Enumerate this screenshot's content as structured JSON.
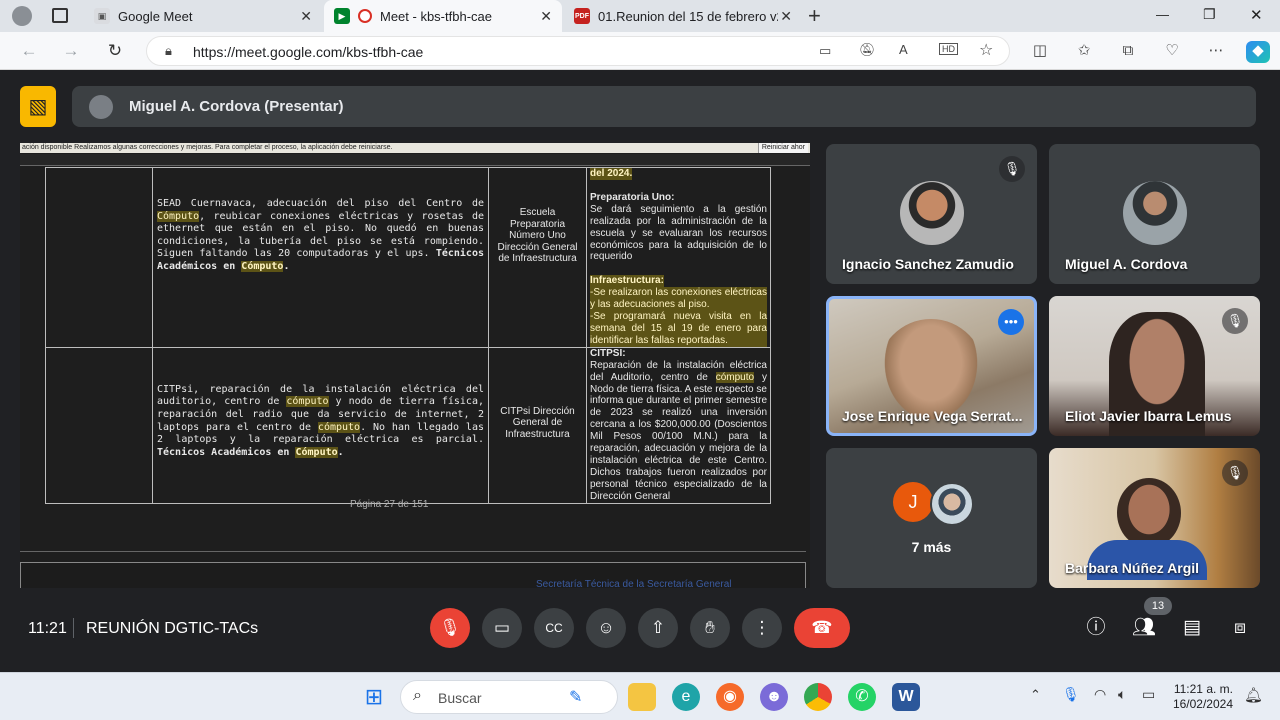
{
  "browser": {
    "tabs": [
      {
        "title": "Google Meet",
        "active": false
      },
      {
        "title": "Meet - kbs-tfbh-cae",
        "active": true
      },
      {
        "title": "01.Reunion del 15 de febrero v2.",
        "active": false
      }
    ],
    "url": "https://meet.google.com/kbs-tfbh-cae",
    "new_tab": "+",
    "window_controls": {
      "minimize": "—",
      "restore": "❐",
      "close": "✕"
    }
  },
  "presenter_bar": {
    "label": "Miguel A. Cordova (Presentar)"
  },
  "document": {
    "update_notice": "ación disponible   Realizamos algunas correcciones y mejoras. Para completar el proceso, la aplicación debe   reiniciarse.",
    "update_button": "Reiniciar ahor",
    "rows": [
      {
        "desc_a": "SEAD Cuernavaca, adecuación del piso del Centro de ",
        "desc_hl1": "Cómputo",
        "desc_b": ", reubicar conexiones eléctricas y rosetas de ethernet que están en el piso. No quedó en buenas condiciones, la tubería del piso se está rompiendo. Siguen faltando las 20 computadoras y el ups. ",
        "desc_bold": "Técnicos Académicos en ",
        "desc_hl2": "Cómputo",
        "desc_end": ".",
        "responsible": "Escuela Preparatoria Número Uno Dirección General de Infraestructura",
        "status_top": "del 2024.",
        "status_h1": "Preparatoria Uno:",
        "status_p1": "Se dará seguimiento a la gestión realizada por la administración de la escuela y se evaluaran los recursos económicos para la adquisición de lo requerido",
        "status_h2": "Infraestructura:",
        "status_p2": "-Se realizaron las conexiones eléctricas y las adecuaciones al piso.",
        "status_p3": "-Se programará nueva visita en la semana del 15 al 19 de enero para identificar las fallas reportadas."
      },
      {
        "desc_a": "CITPsi, reparación de la instalación eléctrica del auditorio, centro de ",
        "desc_hl1": "cómputo",
        "desc_b": " y nodo de tierra física, reparación del radio que da servicio de internet, 2 laptops para el centro de ",
        "desc_hl2": "cómputo",
        "desc_c": ". No han llegado las 2 laptops y la reparación eléctrica es parcial. ",
        "desc_bold": "Técnicos Académicos en ",
        "desc_hl3": "Cómputo",
        "desc_end": ".",
        "responsible": "CITPsi Dirección General de Infraestructura",
        "status_h1": "CITPSI:",
        "status_p1a": "Reparación de la instalación eléctrica del Auditorio, centro de ",
        "status_hl": "cómputo",
        "status_p1b": " y Nodo de tierra física. A este respecto se informa que durante el primer semestre de 2023 se realizó una inversión cercana a los $200,000.00 (Doscientos Mil Pesos 00/100 M.N.) para la reparación, adecuación y mejora de la instalación eléctrica de este Centro. Dichos trabajos fueron realizados por personal técnico especializado de la Dirección General"
      }
    ],
    "page_label": "Página 27 de 151",
    "next_page_header": "Secretaría Técnica de la Secretaría General"
  },
  "participants": [
    {
      "name": "Ignacio Sanchez Zamudio",
      "muted": true,
      "type": "avatar"
    },
    {
      "name": "Miguel A. Cordova",
      "muted": false,
      "type": "avatar"
    },
    {
      "name": "Jose Enrique Vega Serrat...",
      "muted": false,
      "type": "video",
      "active_speaker": true
    },
    {
      "name": "Eliot Javier Ibarra Lemus",
      "muted": true,
      "type": "video"
    },
    {
      "name": "7 más",
      "type": "overflow",
      "initial": "J"
    },
    {
      "name": "Barbara Núñez Argil",
      "muted": true,
      "type": "video"
    }
  ],
  "controls": {
    "time": "11:21",
    "meeting_title": "REUNIÓN DGTIC-TACs",
    "people_count": "13"
  },
  "taskbar": {
    "search_placeholder": "Buscar",
    "time": "11:21 a. m.",
    "date": "16/02/2024"
  },
  "colors": {
    "meet_bg": "#202124",
    "tile_bg": "#3c4043",
    "end_call": "#ea4335",
    "mute_red": "#ea4335",
    "present_yellow": "#f9b800",
    "active_border": "#8ab4f8"
  }
}
